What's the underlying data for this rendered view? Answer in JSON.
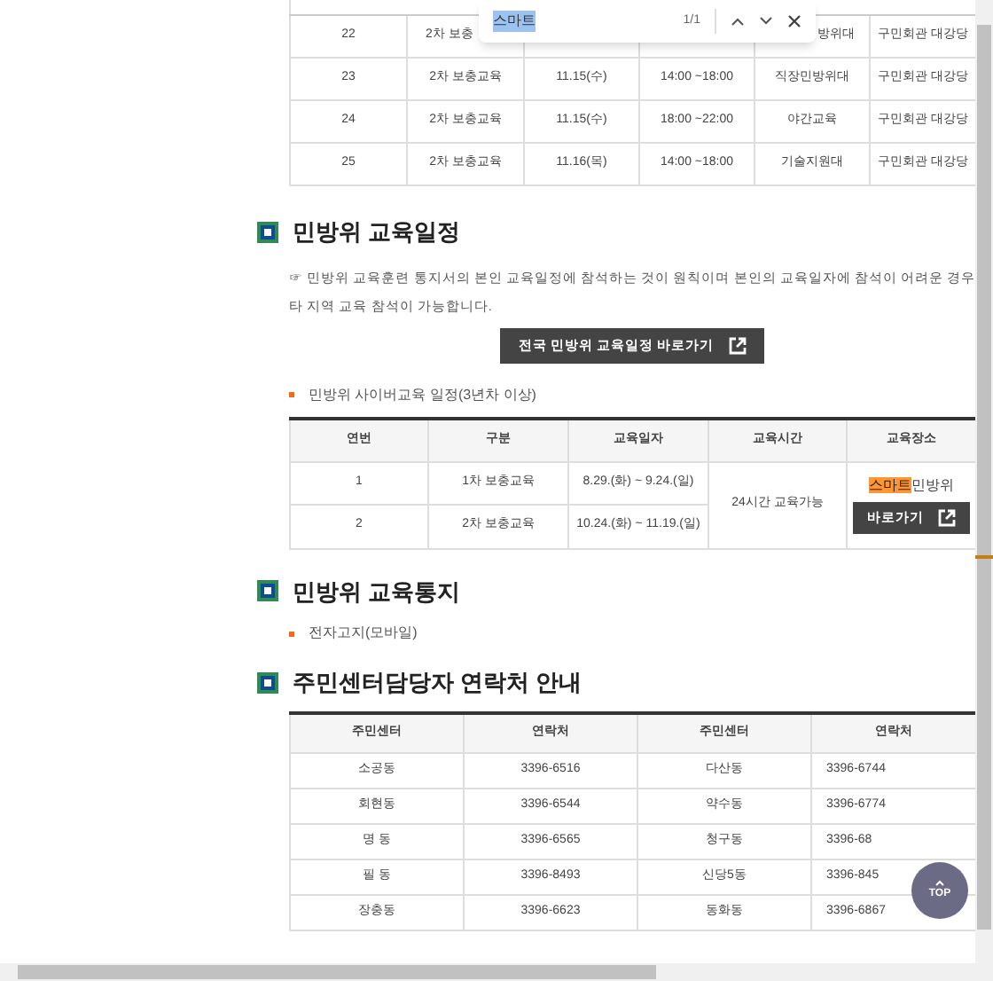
{
  "find_bar": {
    "query": "스마트",
    "count": "1/1"
  },
  "schedule_table": {
    "rows": [
      {
        "cells": [
          "22",
          "2차 보충",
          "",
          "",
          "방위대",
          "구민회관 대강당"
        ]
      },
      {
        "cells": [
          "23",
          "2차 보충교육",
          "11.15(수)",
          "14:00 ~18:00",
          "직장민방위대",
          "구민회관 대강당"
        ]
      },
      {
        "cells": [
          "24",
          "2차 보충교육",
          "11.15(수)",
          "18:00 ~22:00",
          "야간교육",
          "구민회관 대강당"
        ]
      },
      {
        "cells": [
          "25",
          "2차 보충교육",
          "11.16(목)",
          "14:00 ~18:00",
          "기술지원대",
          "구민회관 대강당"
        ]
      }
    ]
  },
  "schedule_section": {
    "title": "민방위 교육일정",
    "notice": "☞ 민방위 교육훈련 통지서의 본인 교육일정에 참석하는 것이 원칙이며 본인의 교육일자에 참석이 어려운 경우 타 지역 교육 참석이 가능합니다.",
    "button": "전국 민방위 교육일정 바로가기",
    "bullet": "민방위 사이버교육 일정(3년차 이상)",
    "table": {
      "columns": [
        "연번",
        "구분",
        "교육일자",
        "교육시간",
        "교육장소"
      ],
      "rows": [
        {
          "cells": [
            "1",
            "1차 보충교육",
            "8.29.(화) ~ 9.24.(일)"
          ]
        },
        {
          "cells": [
            "2",
            "2차 보충교육",
            "10.24.(화) ~ 11.19.(일)"
          ]
        }
      ],
      "time": "24시간 교육가능",
      "place": {
        "match": "스마트",
        "text": "민방위"
      },
      "place_button": "바로가기"
    }
  },
  "notice_section": {
    "title": "민방위 교육통지",
    "bullet": "전자고지(모바일)"
  },
  "contact_section": {
    "title": "주민센터담당자 연락처 안내",
    "columns": [
      "주민센터",
      "연락처",
      "주민센터",
      "연락처"
    ],
    "rows": [
      {
        "cells": [
          "소공동",
          "3396-6516",
          "다산동",
          "3396-6744"
        ]
      },
      {
        "cells": [
          "회현동",
          "3396-6544",
          "약수동",
          "3396-6774"
        ]
      },
      {
        "cells": [
          "명 동",
          "3396-6565",
          "청구동",
          "3396-68"
        ]
      },
      {
        "cells": [
          "필 동",
          "3396-8493",
          "신당5동",
          "3396-845"
        ]
      },
      {
        "cells": [
          "장충동",
          "3396-6623",
          "동화동",
          "3396-6867"
        ]
      }
    ]
  },
  "top_button": "TOP"
}
